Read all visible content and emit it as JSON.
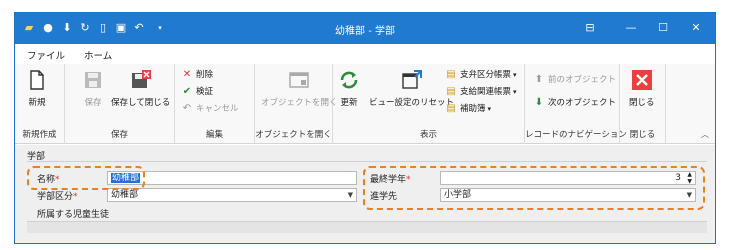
{
  "window": {
    "title": "幼稚部 - 学部"
  },
  "quick_access": {
    "icons": [
      "folder-icon",
      "save-icon",
      "download-icon",
      "refresh-icon",
      "layout-icon",
      "save-close-icon",
      "undo-icon",
      "dropdown-icon"
    ]
  },
  "menu": {
    "file": "ファイル",
    "home": "ホーム"
  },
  "ribbon": {
    "new": "新規",
    "save": "保存",
    "save_close": "保存して閉じる",
    "delete": "削除",
    "verify": "検証",
    "cancel": "キャンセル",
    "open_object": "オブジェクトを開く",
    "refresh": "更新",
    "view_reset": "ビュー設定のリセット",
    "branch_ledger": "支弁区分帳票",
    "supply_ledger": "支給関連帳票",
    "aux_book": "補助簿",
    "prev_object": "前のオブジェクト",
    "next_object": "次のオブジェクト",
    "close": "閉じる",
    "groups": {
      "new_create": "新規作成",
      "save": "保存",
      "edit": "編集",
      "open_object": "オブジェクトを開く",
      "display": "表示",
      "record_nav": "レコードのナビゲーション",
      "close": "閉じる"
    }
  },
  "form": {
    "section": "学部",
    "name_label": "名称",
    "name_value": "幼稚部",
    "dept_label": "学部区分",
    "dept_value": "幼稚部",
    "final_grade_label": "最終学年",
    "final_grade_value": "3",
    "next_school_label": "進学先",
    "next_school_value": "小学部",
    "students_label": "所属する児童生徒",
    "required_mark": "*"
  },
  "colors": {
    "titlebar": "#1f7ad0",
    "highlight": "#e8821e",
    "required": "#e03030",
    "close_red": "#e84040",
    "ok_green": "#2e8b3a"
  }
}
